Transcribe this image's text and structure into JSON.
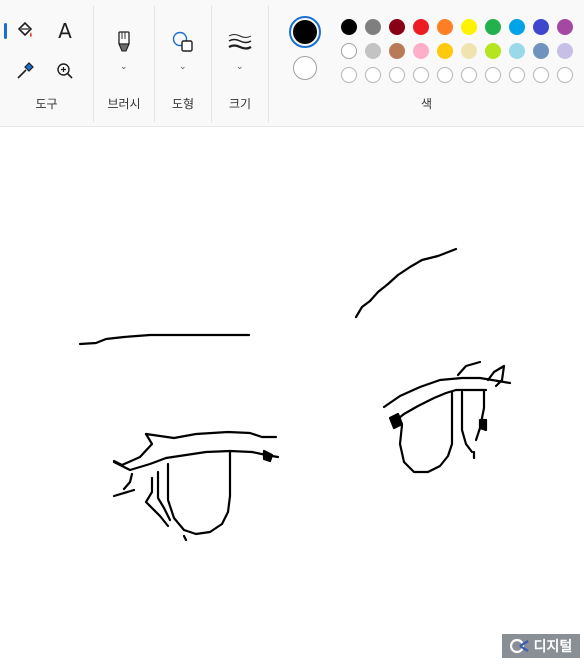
{
  "toolbar": {
    "groups": {
      "tools": "도구",
      "brushes": "브러시",
      "shapes": "도형",
      "size": "크기",
      "colors": "색"
    },
    "text_tool_glyph": "A"
  },
  "colors": {
    "primary": "#000000",
    "secondary": "#ffffff",
    "accent": "#1a6fd1",
    "row1": [
      "#000000",
      "#7f7f7f",
      "#880015",
      "#ed1c24",
      "#ff7f27",
      "#fff200",
      "#22b14c",
      "#00a2e8",
      "#3f48cc",
      "#a349a4"
    ],
    "row2": [
      "#ffffff",
      "#c3c3c3",
      "#b97a57",
      "#ffaec9",
      "#ffc90e",
      "#efe4b0",
      "#b5e61d",
      "#99d9ea",
      "#7092be",
      "#c8bfe7"
    ],
    "row3_custom_slots": 10
  },
  "watermark": {
    "label": "디지털"
  },
  "icons": [
    "fill-icon",
    "text-icon",
    "color-picker-icon",
    "magnifier-icon",
    "brush-icon",
    "shapes-icon",
    "size-icon"
  ]
}
